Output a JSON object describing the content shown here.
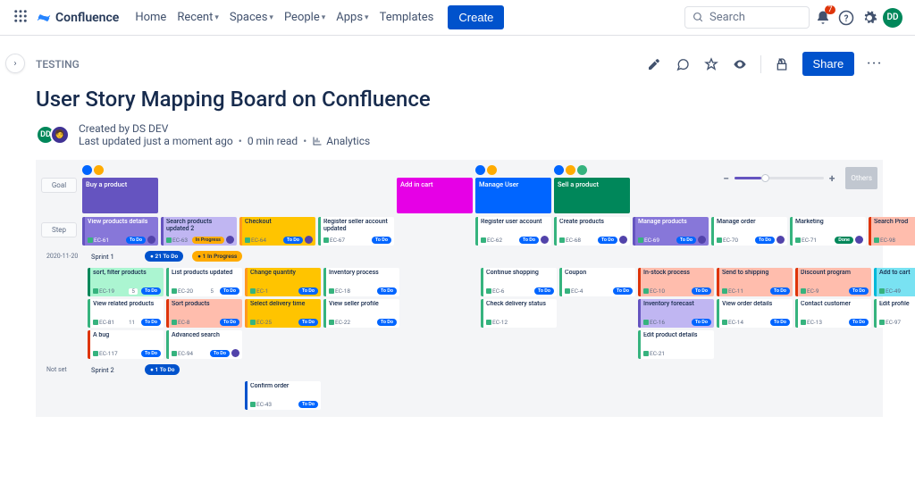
{
  "nav": {
    "product": "Confluence",
    "items": [
      "Home",
      "Recent",
      "Spaces",
      "People",
      "Apps",
      "Templates"
    ],
    "create": "Create",
    "search_placeholder": "Search",
    "bell_count": "7",
    "avatar_initials": "DD"
  },
  "page": {
    "breadcrumb": "TESTING",
    "title": "User Story Mapping Board on Confluence",
    "author_line": "Created by DS DEV",
    "byline": "Last updated just a moment ago",
    "read_time": "0 min read",
    "analytics": "Analytics",
    "share": "Share",
    "author_avatars": [
      "DD",
      "🧑"
    ]
  },
  "board": {
    "labels": {
      "goal": "Goal",
      "step": "Step",
      "others": "Others"
    },
    "goals": [
      {
        "col": 0,
        "color": "purple",
        "title": "Buy a product",
        "icons": [
          "b",
          "y"
        ]
      },
      {
        "col": 4,
        "color": "magenta",
        "title": "Add in cart",
        "icons": []
      },
      {
        "col": 5,
        "color": "blue",
        "title": "Manage User",
        "icons": [
          "b",
          "y"
        ]
      },
      {
        "col": 6,
        "color": "green",
        "title": "Sell a product",
        "icons": [
          "b",
          "y",
          "g"
        ]
      }
    ],
    "steps": [
      {
        "col": 0,
        "bg": "bg-purple",
        "title": "View products details",
        "key": "EC-61",
        "status": "To Do",
        "st": "todo",
        "av": 1
      },
      {
        "col": 1,
        "bg": "bg-lpurple",
        "title": "Search products updated 2",
        "key": "EC-63",
        "status": "In Progress",
        "st": "prog",
        "av": 1
      },
      {
        "col": 2,
        "bg": "bg-yellow",
        "title": "Checkout",
        "key": "EC-64",
        "status": "To Do",
        "st": "todo",
        "av": 1
      },
      {
        "col": 3,
        "bg": "bg-white",
        "title": "Register seller account updated",
        "key": "EC-67",
        "status": "To Do",
        "st": "todo"
      },
      {
        "col": 5,
        "bg": "bg-white",
        "title": "Register user account",
        "key": "EC-62",
        "status": "To Do",
        "st": "todo",
        "av": 1
      },
      {
        "col": 6,
        "bg": "bg-white",
        "title": "Create products",
        "key": "EC-68",
        "status": "To Do",
        "st": "todo",
        "av": 1
      },
      {
        "col": 7,
        "bg": "bg-purple",
        "title": "Manage products",
        "key": "EC-69",
        "status": "To Do",
        "st": "todo",
        "av": 1
      },
      {
        "col": 8,
        "bg": "bg-white",
        "title": "Manage order",
        "key": "EC-70",
        "status": "To Do",
        "st": "todo",
        "av": 1
      },
      {
        "col": 9,
        "bg": "bg-white",
        "title": "Marketing",
        "key": "EC-71",
        "status": "Done",
        "st": "done",
        "av": 1
      },
      {
        "col": 10,
        "bg": "bg-salmon",
        "title": "Search Prod",
        "key": "EC-98",
        "status": "",
        "st": "todo"
      }
    ],
    "sprints": [
      {
        "date": "2020-11-20",
        "name": "Sprint 1",
        "pills": [
          {
            "text": "21 To Do",
            "cls": "blue"
          },
          {
            "text": "1 In Progress",
            "cls": "amber"
          }
        ],
        "rows": [
          {
            "col": 0,
            "bg": "bg-mint",
            "title": "sort, filter products",
            "key": "EC-19",
            "status": "To Do",
            "st": "todo",
            "cnt": "5"
          },
          {
            "col": 1,
            "bg": "bg-white",
            "title": "List products updated",
            "key": "EC-20",
            "status": "To Do",
            "st": "todo",
            "cnt": "5"
          },
          {
            "col": 2,
            "bg": "bg-yellow",
            "title": "Change quantity",
            "key": "EC-1",
            "status": "To Do",
            "st": "todo"
          },
          {
            "col": 3,
            "bg": "bg-white",
            "title": "Inventory process",
            "key": "EC-18",
            "status": "To Do",
            "st": "todo"
          },
          {
            "col": 5,
            "bg": "bg-white",
            "title": "Continue shopping",
            "key": "EC-6",
            "status": "To Do",
            "st": "todo"
          },
          {
            "col": 6,
            "bg": "bg-white",
            "title": "Coupon",
            "key": "EC-4",
            "status": "To Do",
            "st": "todo"
          },
          {
            "col": 7,
            "bg": "bg-salmon",
            "title": "In-stock process",
            "key": "EC-10",
            "status": "To Do",
            "st": "todo"
          },
          {
            "col": 8,
            "bg": "bg-salmon",
            "title": "Send to shipping",
            "key": "EC-11",
            "status": "To Do",
            "st": "todo"
          },
          {
            "col": 9,
            "bg": "bg-salmon",
            "title": "Discount program",
            "key": "EC-9",
            "status": "To Do",
            "st": "todo"
          },
          {
            "col": 10,
            "bg": "bg-cyan",
            "title": "Add to cart",
            "key": "EC-49",
            "status": "",
            "st": "todo"
          }
        ],
        "rows2": [
          {
            "col": 0,
            "bg": "bg-white",
            "title": "View related products",
            "key": "EC-81",
            "status": "To Do",
            "st": "todo",
            "cnt": "11"
          },
          {
            "col": 1,
            "bg": "bg-salmon",
            "title": "Sort products",
            "key": "EC-8",
            "status": "To Do",
            "st": "todo"
          },
          {
            "col": 2,
            "bg": "bg-yellow",
            "title": "Select delivery time",
            "key": "EC-25",
            "status": "To Do",
            "st": "todo"
          },
          {
            "col": 3,
            "bg": "bg-white",
            "title": "View seller profile",
            "key": "EC-22",
            "status": "To Do",
            "st": "todo"
          },
          {
            "col": 5,
            "bg": "bg-white",
            "title": "Check delivery status",
            "key": "EC-12",
            "status": "",
            "st": "todo"
          },
          {
            "col": 7,
            "bg": "bg-lpurple",
            "title": "Inventory forecast",
            "key": "EC-16",
            "status": "To Do",
            "st": "todo"
          },
          {
            "col": 8,
            "bg": "bg-white",
            "title": "View order details",
            "key": "EC-14",
            "status": "To Do",
            "st": "todo"
          },
          {
            "col": 9,
            "bg": "bg-white",
            "title": "Contact customer",
            "key": "EC-13",
            "status": "To Do",
            "st": "todo"
          },
          {
            "col": 10,
            "bg": "bg-white",
            "title": "Edit profile",
            "key": "EC-97",
            "status": "",
            "st": "todo"
          }
        ],
        "rows3": [
          {
            "col": 0,
            "bg": "bg-wred",
            "title": "A bug",
            "key": "EC-117",
            "status": "To Do",
            "st": "todo"
          },
          {
            "col": 1,
            "bg": "bg-white",
            "title": "Advanced search",
            "key": "EC-94",
            "status": "To Do",
            "st": "todo",
            "av": 1
          },
          {
            "col": 7,
            "bg": "bg-white",
            "title": "Edit product details",
            "key": "EC-21",
            "status": "",
            "st": "todo"
          }
        ]
      },
      {
        "date": "Not set",
        "name": "Sprint 2",
        "pills": [
          {
            "text": "1 To Do",
            "cls": "blue"
          }
        ],
        "rows": [
          {
            "col": 2,
            "bg": "bg-dblue",
            "title": "Confirm order",
            "key": "EC-43",
            "status": "To Do",
            "st": "todo"
          }
        ],
        "rows2": [],
        "rows3": []
      }
    ]
  }
}
